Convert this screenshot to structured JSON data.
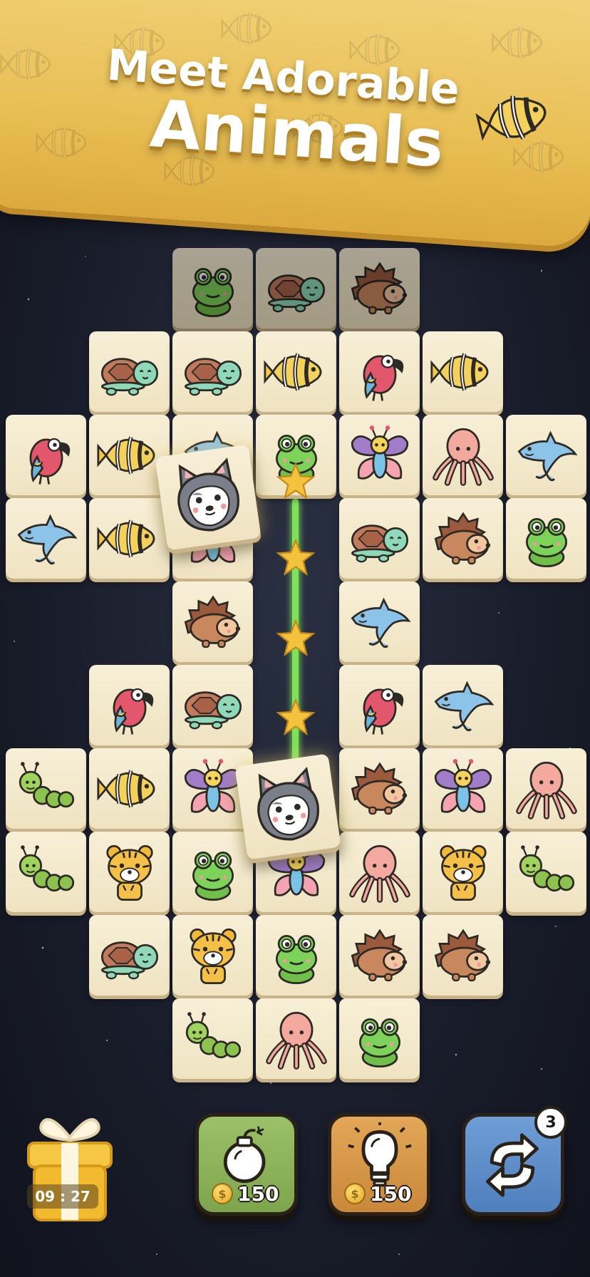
{
  "banner": {
    "line1": "Meet Adorable",
    "line2": "Animals",
    "decor_icon": "angelfish-icon"
  },
  "board": {
    "tiles": [
      {
        "animal": "frog",
        "dim": true
      },
      {
        "animal": "turtle",
        "dim": true
      },
      {
        "animal": "hedgehog",
        "dim": true
      },
      {
        "animal": "turtle"
      },
      {
        "animal": "turtle"
      },
      {
        "animal": "fish"
      },
      {
        "animal": "parrot"
      },
      {
        "animal": "fish"
      },
      {
        "animal": "parrot"
      },
      {
        "animal": "fish"
      },
      {
        "animal": "dolphin"
      },
      {
        "animal": "frog"
      },
      {
        "animal": "butterfly"
      },
      {
        "animal": "octopus"
      },
      {
        "animal": "dolphin"
      },
      {
        "animal": "dolphin"
      },
      {
        "animal": "fish"
      },
      {
        "animal": "butterfly"
      },
      {
        "animal": "turtle"
      },
      {
        "animal": "hedgehog"
      },
      {
        "animal": "frog"
      },
      {
        "animal": "hedgehog"
      },
      {
        "animal": "dolphin"
      },
      {
        "animal": "parrot"
      },
      {
        "animal": "turtle"
      },
      {
        "animal": "parrot"
      },
      {
        "animal": "dolphin"
      },
      {
        "animal": "caterpillar"
      },
      {
        "animal": "fish"
      },
      {
        "animal": "butterfly"
      },
      {
        "animal": "hedgehog"
      },
      {
        "animal": "butterfly"
      },
      {
        "animal": "octopus"
      },
      {
        "animal": "caterpillar"
      },
      {
        "animal": "tiger"
      },
      {
        "animal": "frog"
      },
      {
        "animal": "butterfly"
      },
      {
        "animal": "octopus"
      },
      {
        "animal": "tiger"
      },
      {
        "animal": "caterpillar"
      },
      {
        "animal": "turtle"
      },
      {
        "animal": "tiger"
      },
      {
        "animal": "frog"
      },
      {
        "animal": "hedgehog"
      },
      {
        "animal": "hedgehog"
      },
      {
        "animal": "caterpillar"
      },
      {
        "animal": "octopus"
      },
      {
        "animal": "frog"
      }
    ],
    "selected": [
      {
        "animal": "wolf"
      },
      {
        "animal": "wolf"
      }
    ],
    "match_path_stars": 4
  },
  "bottom_bar": {
    "gift": {
      "timer": "09 : 27",
      "icon": "gift-box-icon"
    },
    "bomb": {
      "price": "150",
      "icon": "bomb-icon"
    },
    "hint": {
      "price": "150",
      "icon": "lightbulb-icon"
    },
    "shuffle": {
      "count": "3",
      "icon": "shuffle-icon"
    }
  },
  "colors": {
    "banner": "#e9bf55",
    "tile": "#f2e8cc",
    "path": "#7fe05a",
    "bomb_button": "#8cb35a",
    "hint_button": "#d6964a",
    "shuffle_button": "#5f8ecb"
  }
}
